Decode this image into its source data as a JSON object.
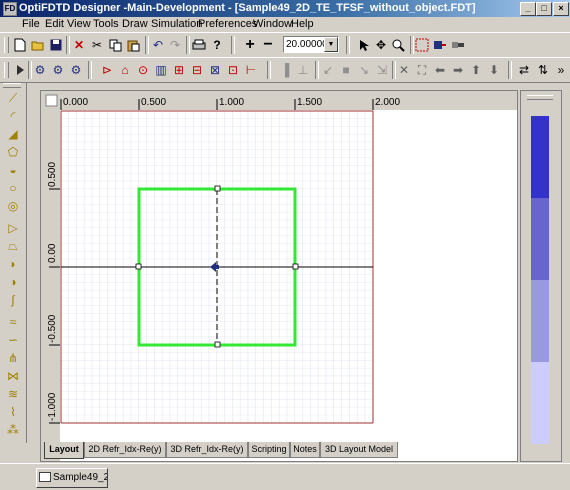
{
  "window": {
    "title": "OptiFDTD Designer -Main-Development - [Sample49_2D_TE_TFSF_without_object.FDT]",
    "app_icon": "FD",
    "buttons": {
      "minimize": "_",
      "maximize": "□",
      "close": "×"
    }
  },
  "menu": [
    "File",
    "Edit",
    "View",
    "Tools",
    "Draw",
    "Simulation",
    "Preferences",
    "Window",
    "Help"
  ],
  "toolbar1": {
    "zoom_value": "20.00000",
    "icons": [
      "new-icon",
      "open-icon",
      "save-icon",
      "delete-icon",
      "cut-icon",
      "copy-icon",
      "paste-icon",
      "undo-icon",
      "redo-icon",
      "print-icon",
      "help-icon",
      "zoom-in-plus-icon",
      "zoom-out-minus-icon",
      "select-arrow-icon",
      "pan-icon",
      "zoom-icon",
      "grid-icon",
      "input-plane-icon",
      "wave-icon"
    ]
  },
  "canvas": {
    "x_ticks": [
      "0.000",
      "0.500",
      "1.000",
      "1.500",
      "2.000"
    ],
    "y_ticks": [
      "0.500",
      "0.00",
      "-0.500",
      "-1.000"
    ],
    "colors": {
      "grid": "#c8d0e8",
      "border": "#a03030",
      "square": "#33e833",
      "axis": "#000000"
    }
  },
  "tabs": [
    "Layout",
    "2D Refr_Idx-Re(y)",
    "3D Refr_Idx-Re(y)",
    "Scripting",
    "Notes",
    "3D Layout Model"
  ],
  "active_tab": "Layout",
  "taskbar": {
    "item": "Sample49_2..."
  },
  "colorbar": {
    "colors": [
      "#3333cc",
      "#6666cc",
      "#9999dd",
      "#ccccff"
    ]
  }
}
